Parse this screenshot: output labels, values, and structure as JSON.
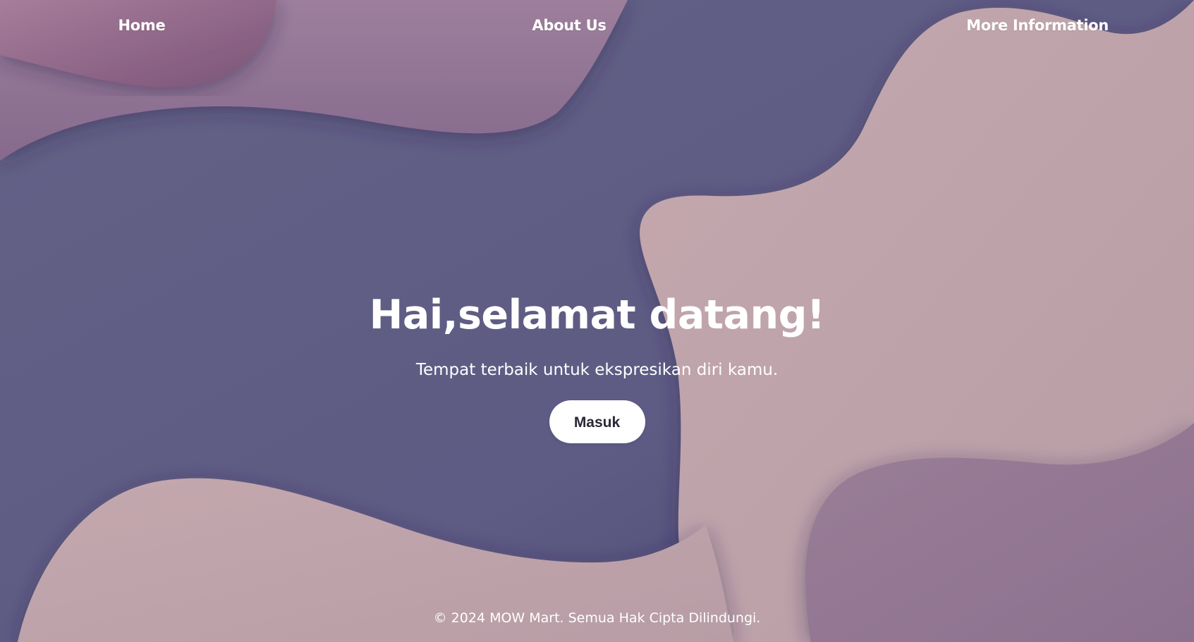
{
  "nav": {
    "home_label": "Home",
    "about_label": "About Us",
    "more_info_label": "More Information"
  },
  "hero": {
    "title": "Hai,selamat datang!",
    "subtitle": "Tempat terbaik untuk ekspresikan diri kamu.",
    "button_label": "Masuk"
  },
  "footer": {
    "copyright": "© 2024 MOW Mart. Semua Hak Cipta Dilindungi."
  },
  "colors": {
    "indigo_background": "#615f86",
    "mauve_top": "#977b98",
    "pink_lilac": "#bea5ab",
    "button_background": "#ffffff",
    "button_text": "#2b2738",
    "text": "#ffffff"
  }
}
